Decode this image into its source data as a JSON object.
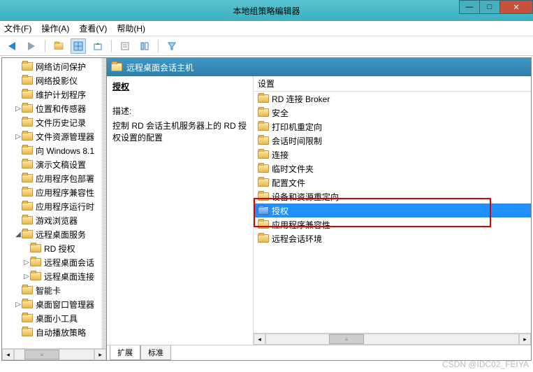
{
  "window": {
    "title": "本地组策略编辑器"
  },
  "menu": {
    "file": "文件(F)",
    "action": "操作(A)",
    "view": "查看(V)",
    "help": "帮助(H)"
  },
  "tree": {
    "items": [
      {
        "label": "网络访问保护",
        "indent": 1,
        "expander": ""
      },
      {
        "label": "网络投影仪",
        "indent": 1,
        "expander": ""
      },
      {
        "label": "维护计划程序",
        "indent": 1,
        "expander": ""
      },
      {
        "label": "位置和传感器",
        "indent": 1,
        "expander": "▷"
      },
      {
        "label": "文件历史记录",
        "indent": 1,
        "expander": ""
      },
      {
        "label": "文件资源管理器",
        "indent": 1,
        "expander": "▷"
      },
      {
        "label": "向 Windows 8.1",
        "indent": 1,
        "expander": ""
      },
      {
        "label": "演示文稿设置",
        "indent": 1,
        "expander": ""
      },
      {
        "label": "应用程序包部署",
        "indent": 1,
        "expander": ""
      },
      {
        "label": "应用程序兼容性",
        "indent": 1,
        "expander": ""
      },
      {
        "label": "应用程序运行时",
        "indent": 1,
        "expander": ""
      },
      {
        "label": "游戏浏览器",
        "indent": 1,
        "expander": ""
      },
      {
        "label": "远程桌面服务",
        "indent": 1,
        "expander": "◢"
      },
      {
        "label": "RD 授权",
        "indent": 2,
        "expander": ""
      },
      {
        "label": "远程桌面会话",
        "indent": 2,
        "expander": "▷"
      },
      {
        "label": "远程桌面连接",
        "indent": 2,
        "expander": "▷"
      },
      {
        "label": "智能卡",
        "indent": 1,
        "expander": ""
      },
      {
        "label": "桌面窗口管理器",
        "indent": 1,
        "expander": "▷"
      },
      {
        "label": "桌面小工具",
        "indent": 1,
        "expander": ""
      },
      {
        "label": "自动播放策略",
        "indent": 1,
        "expander": ""
      }
    ]
  },
  "header": {
    "title": "远程桌面会话主机"
  },
  "description": {
    "title": "授权",
    "label": "描述:",
    "text": "控制 RD 会话主机服务器上的 RD 授权设置的配置"
  },
  "list": {
    "column": "设置",
    "items": [
      {
        "label": "RD 连接 Broker",
        "selected": false
      },
      {
        "label": "安全",
        "selected": false
      },
      {
        "label": "打印机重定向",
        "selected": false
      },
      {
        "label": "会话时间限制",
        "selected": false
      },
      {
        "label": "连接",
        "selected": false
      },
      {
        "label": "临时文件夹",
        "selected": false
      },
      {
        "label": "配置文件",
        "selected": false
      },
      {
        "label": "设备和资源重定向",
        "selected": false
      },
      {
        "label": "授权",
        "selected": true
      },
      {
        "label": "应用程序兼容性",
        "selected": false
      },
      {
        "label": "远程会话环境",
        "selected": false
      }
    ]
  },
  "tabs": {
    "extended": "扩展",
    "standard": "标准"
  },
  "watermark": "CSDN @IDC02_FEIYA"
}
